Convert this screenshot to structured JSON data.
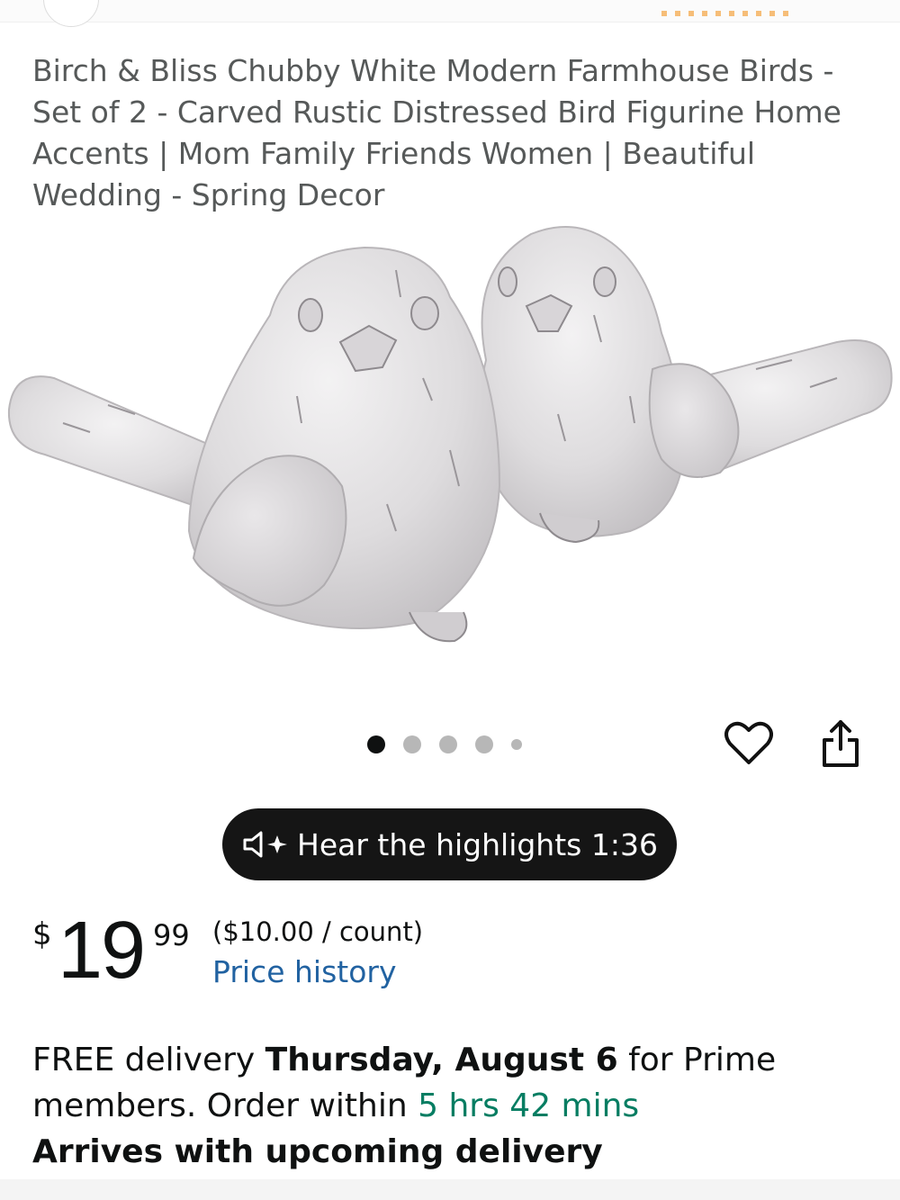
{
  "product": {
    "title": "Birch & Bliss Chubby White Modern Farmhouse Birds - Set of 2 - Carved Rustic Distressed Bird Figurine Home Accents | Mom Family Friends Women | Beautiful Wedding - Spring Decor",
    "image_alt": "two-white-carved-bird-figurines",
    "carousel": {
      "total_dots": 5,
      "active_index": 0
    }
  },
  "actions": {
    "wishlist_icon": "heart-icon",
    "share_icon": "share-icon"
  },
  "highlights": {
    "label": "Hear the highlights 1:36",
    "icon": "speaker-sparkle-icon"
  },
  "price": {
    "symbol": "$",
    "whole": "19",
    "fraction": "99",
    "unit_price": "($10.00 / count)",
    "history_link": "Price history"
  },
  "delivery": {
    "prefix": "FREE delivery ",
    "date": "Thursday, August 6",
    "middle": " for Prime members. Order within ",
    "countdown": "5 hrs 42 mins",
    "arrives": "Arrives with upcoming delivery"
  },
  "colors": {
    "title_text": "#565959",
    "link": "#2162a1",
    "countdown": "#067d62",
    "pill_bg": "#151515"
  }
}
